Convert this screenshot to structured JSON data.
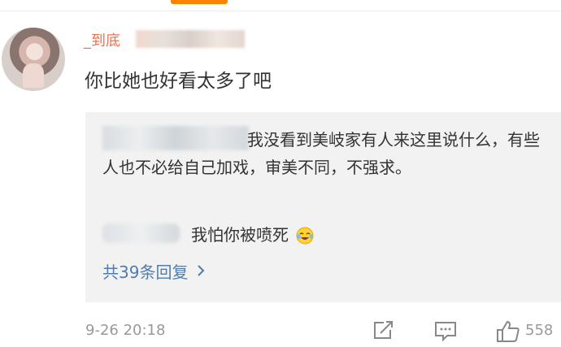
{
  "comment": {
    "username_prefix": "_到底",
    "text": "你比她也好看太多了吧",
    "timestamp": "9-26 20:18",
    "like_count": "558"
  },
  "replies": {
    "reply1_text": "我没看到美岐家有人来这里说什么，有些人也不必给自己加戏，审美不同，不强求。",
    "reply2_text": "我怕你被喷死",
    "reply2_emoji": "laughing-tears-icon",
    "more_replies_label": "共39条回复"
  },
  "icons": {
    "share": "share-icon",
    "comment": "comment-icon",
    "like": "thumbs-up-icon"
  },
  "colors": {
    "username": "#eb7350",
    "link": "#507daf",
    "reply_bg": "#f2f2f2",
    "meta": "#999999",
    "accent": "#ff8200"
  }
}
